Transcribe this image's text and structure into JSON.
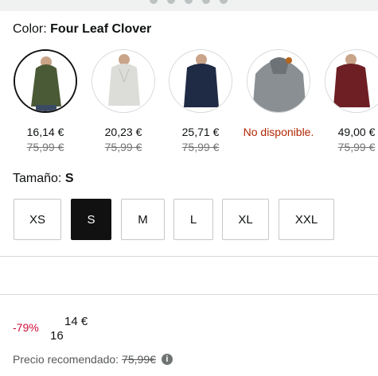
{
  "color_section": {
    "label": "Color:",
    "selected": "Four Leaf Clover"
  },
  "swatches": [
    {
      "price": "16,14 €",
      "old_price": "75,99 €",
      "unavailable": "",
      "color": "#4a5a36"
    },
    {
      "price": "20,23 €",
      "old_price": "75,99 €",
      "unavailable": "",
      "color": "#d9d9d6"
    },
    {
      "price": "25,71 €",
      "old_price": "75,99 €",
      "unavailable": "",
      "color": "#1f2a44"
    },
    {
      "price": "",
      "old_price": "",
      "unavailable": "No disponible.",
      "color": "#8a8f93"
    },
    {
      "price": "49,00 €",
      "old_price": "75,99 €",
      "unavailable": "",
      "color": "#6e1f24"
    }
  ],
  "size_section": {
    "label": "Tamaño:",
    "selected": "S"
  },
  "sizes": [
    "XS",
    "S",
    "M",
    "L",
    "XL",
    "XXL"
  ],
  "pricing": {
    "discount": "-79%",
    "currency_symbol": "14 €",
    "price_whole": "16",
    "rrp_label": "Precio recomendado:",
    "rrp_value": "75,99€",
    "info_glyph": "i"
  },
  "colors": {
    "discount": "#cc0c39",
    "unavailable": "#b12704",
    "selected_size_bg": "#111111"
  }
}
